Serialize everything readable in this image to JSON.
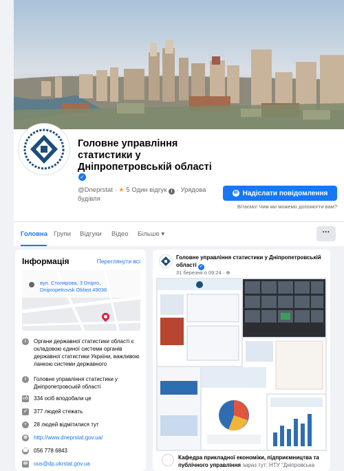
{
  "header": {
    "page_name": "Головне управління статистики у Дніпропетровській області",
    "username": "@Dneprstat",
    "rating": "5 Один відгук",
    "category": "Урядова будівля",
    "message_button": "Надіслати повідомлення",
    "message_hint": "Вітаємо! Чим ми можемо допомогти вам?"
  },
  "tabs": [
    {
      "label": "Головна",
      "active": true
    },
    {
      "label": "Групи"
    },
    {
      "label": "Відгуки"
    },
    {
      "label": "Відео"
    },
    {
      "label": "Більше ▾"
    }
  ],
  "more_label": "···",
  "info": {
    "title": "Інформація",
    "see_all": "Переглянути всі",
    "address": "вул. Столярова, 3 Dnipro, Dnipropetrovsk Oblast 49038",
    "description": "Органи державної статистики області є складовою єдиної системи органів державної статистики України, важливою ланкою системи державного",
    "org": "Головне управління статистики у Дніпропетровській області",
    "likes": "334 осіб вподобали це",
    "followers": "377 людей стежать",
    "checkins": "28 людей відмітилися тут",
    "website": "http://www.dneprstat.gov.ua/",
    "phone": "056 778 6843",
    "email": "ous@dp.ukrstat.gov.ua"
  },
  "post": {
    "author": "Головне управління статистики у Дніпропетровській області",
    "time": "31 березня о 09:24 · ⊕",
    "next_author": "Кафедра прикладної економіки, підприємництва та публічного управління",
    "next_text": " зараз тут: НТУ \"Дніпровська"
  },
  "colors": {
    "accent": "#1877f2",
    "background": "#f0f2f5"
  }
}
